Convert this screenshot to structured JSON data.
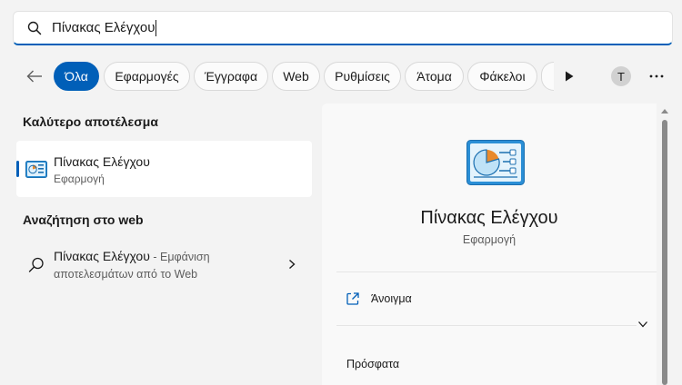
{
  "search": {
    "value": "Πίνακας Ελέγχου"
  },
  "filters": {
    "chips": [
      {
        "label": "Όλα",
        "active": true
      },
      {
        "label": "Εφαρμογές"
      },
      {
        "label": "Έγγραφα"
      },
      {
        "label": "Web"
      },
      {
        "label": "Ρυθμίσεις"
      },
      {
        "label": "Άτομα"
      },
      {
        "label": "Φάκελοι"
      }
    ],
    "avatar_initial": "T"
  },
  "left": {
    "best_match_heading": "Καλύτερο αποτέλεσμα",
    "best_match": {
      "title": "Πίνακας Ελέγχου",
      "subtitle": "Εφαρμογή"
    },
    "web_heading": "Αναζήτηση στο web",
    "web_result": {
      "title": "Πίνακας Ελέγχου",
      "suffix": " - Εμφάνιση",
      "line2": "αποτελεσμάτων από το Web"
    }
  },
  "detail": {
    "title": "Πίνακας Ελέγχου",
    "subtitle": "Εφαρμογή",
    "open_label": "Άνοιγμα",
    "recent_heading": "Πρόσφατα"
  },
  "colors": {
    "accent": "#005fb8",
    "background": "#f3f3f3",
    "panel": "#f9f9f9"
  }
}
